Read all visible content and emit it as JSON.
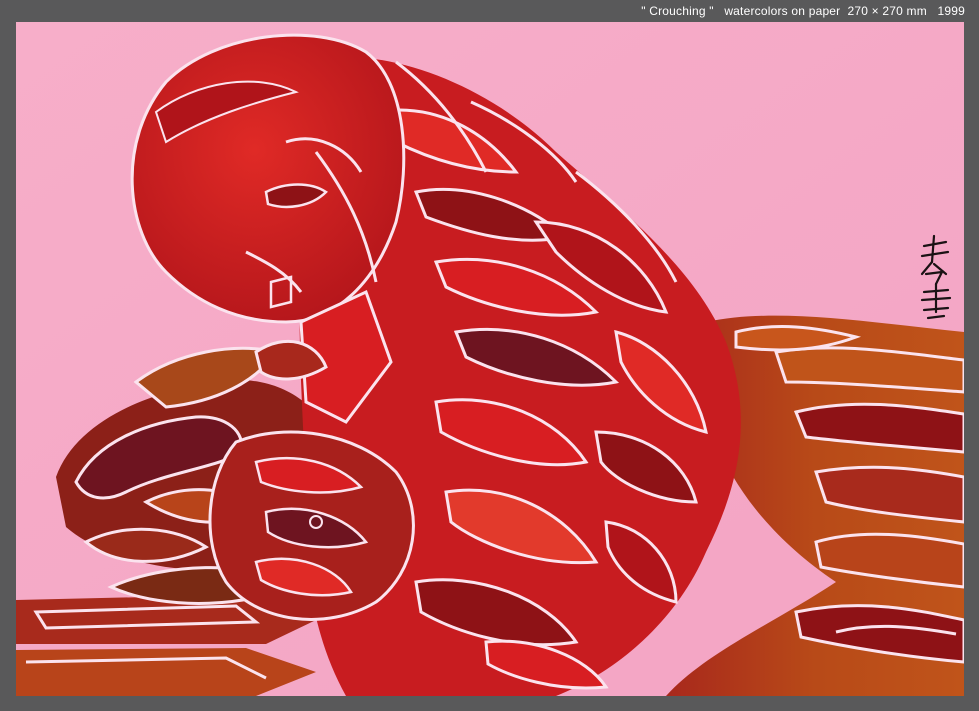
{
  "caption": {
    "text": "\" Crouching \"   watercolors on paper  270 × 270 mm   1999"
  },
  "artwork": {
    "subject": "crouching-figure-watercolor",
    "signature_glyphs": "秀寿"
  },
  "colors": {
    "frame": "#59595a",
    "paper_pink": "#f5a8c6",
    "red_main": "#d81e22",
    "red_dark": "#8e1216",
    "maroon": "#6e1420",
    "rust_orange": "#b84a18",
    "brown": "#7a2a14",
    "outline_white": "#fbe3ee"
  }
}
